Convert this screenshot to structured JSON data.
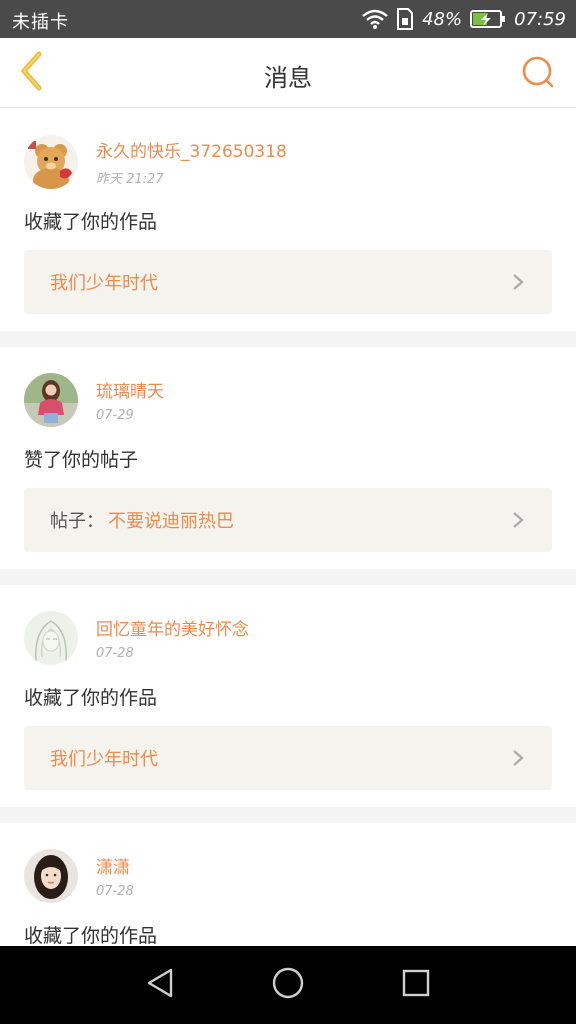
{
  "status_bar": {
    "carrier": "未插卡",
    "battery_percent": "48%",
    "time": "07:59",
    "icons": [
      "wifi-icon",
      "sim-icon",
      "battery-charging-icon"
    ]
  },
  "header": {
    "title": "消息",
    "back_icon": "chevron-left-icon",
    "search_icon": "search-icon"
  },
  "colors": {
    "accent": "#f08a4b",
    "back_icon": "#f2c94c",
    "link_bg": "#f4f3ed",
    "status_bar_bg": "#4a4a4a"
  },
  "messages": [
    {
      "user": "永久的快乐_372650318",
      "time": "昨天 21:27",
      "action": "收藏了你的作品",
      "link_prefix": "",
      "link_text": "我们少年时代",
      "avatar": "teddy-bear-avatar"
    },
    {
      "user": "琉璃晴天",
      "time": "07-29",
      "action": "赞了你的帖子",
      "link_prefix": "帖子：",
      "link_text": "不要说迪丽热巴",
      "avatar": "girl-photo-avatar"
    },
    {
      "user": "回忆童年的美好怀念",
      "time": "07-28",
      "action": "收藏了你的作品",
      "link_prefix": "",
      "link_text": "我们少年时代",
      "avatar": "sketch-girl-avatar"
    },
    {
      "user": "潇潇",
      "time": "07-28",
      "action": "收藏了你的作品",
      "link_prefix": "",
      "link_text": "",
      "avatar": "woman-portrait-avatar"
    }
  ],
  "nav_bar": {
    "buttons": [
      "back-triangle-icon",
      "home-circle-icon",
      "recents-square-icon"
    ]
  }
}
